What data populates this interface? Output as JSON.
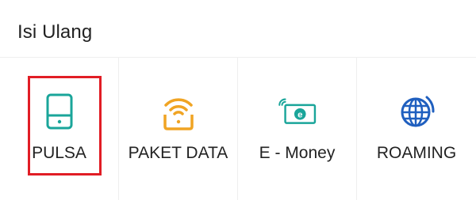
{
  "header": {
    "title": "Isi Ulang"
  },
  "menu": {
    "items": [
      {
        "label": "PULSA",
        "icon": "phone-icon",
        "color": "#1aa59a"
      },
      {
        "label": "PAKET DATA",
        "icon": "wifi-icon",
        "color": "#f0a423"
      },
      {
        "label": "E - Money",
        "icon": "emoney-card-icon",
        "color": "#1aa59a"
      },
      {
        "label": "ROAMING",
        "icon": "globe-icon",
        "color": "#1f5fbf"
      }
    ],
    "selected_index": 0,
    "highlight_color": "#e11d25"
  }
}
